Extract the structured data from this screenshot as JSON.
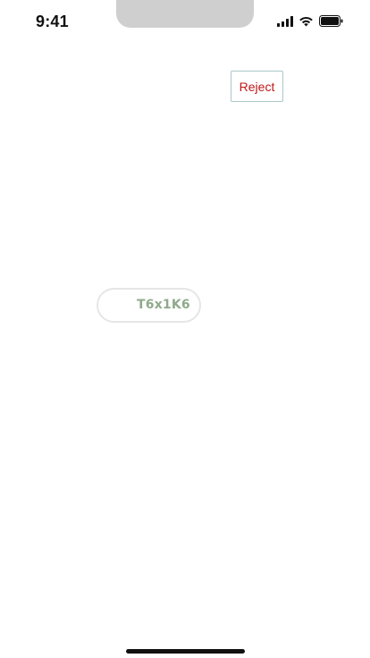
{
  "status_bar": {
    "time": "9:41",
    "icons": [
      "cellular-signal-icon",
      "wifi-icon",
      "battery-icon"
    ]
  },
  "reject_button": {
    "label": "Reject",
    "text_color": "#c01818",
    "border_color": "#a9c7c6"
  },
  "code_pill": {
    "code": "T6x1K6",
    "text_color": "#8faa8b"
  }
}
